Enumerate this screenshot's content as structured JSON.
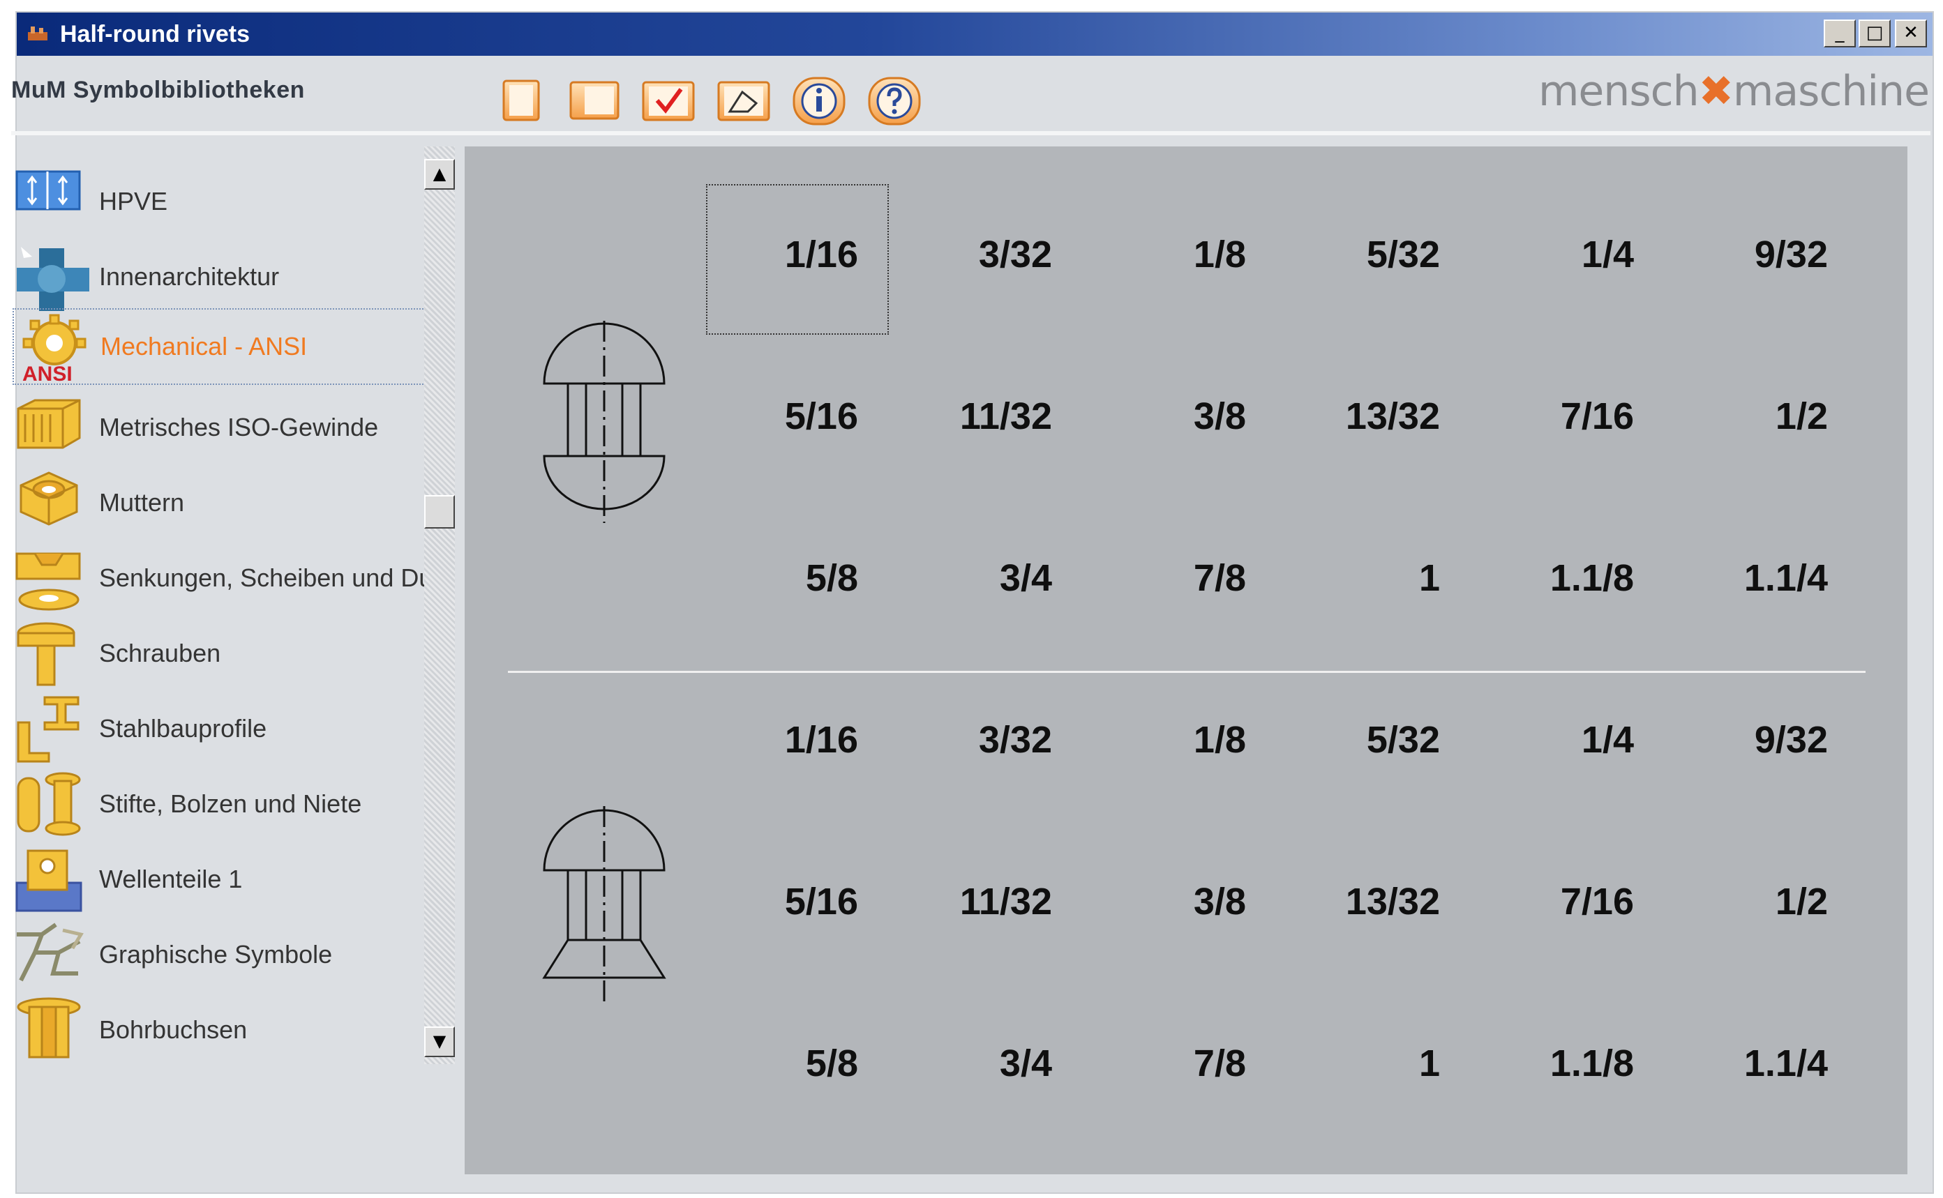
{
  "window": {
    "title": "Half-round rivets",
    "controls": [
      "_",
      "□",
      "✕"
    ]
  },
  "toolbar": {
    "library_title": "MuM Symbolbibliotheken",
    "buttons": [
      "new-doc",
      "open-panel",
      "check",
      "place-symbol",
      "info",
      "help"
    ],
    "brand": {
      "left": "mensch",
      "mark": "✖",
      "right": "maschine"
    }
  },
  "sidebar": {
    "selected_index": 2,
    "items": [
      {
        "label": "HPVE",
        "icon": "hpve-icon"
      },
      {
        "label": "Innenarchitektur",
        "icon": "interior-icon"
      },
      {
        "label": "Mechanical - ANSI",
        "icon": "gear-ansi-icon",
        "badge": "ANSI"
      },
      {
        "label": "Metrisches ISO-Gewinde",
        "icon": "thread-icon"
      },
      {
        "label": "Muttern",
        "icon": "nut-icon"
      },
      {
        "label": "Senkungen, Scheiben und Du",
        "icon": "washer-icon"
      },
      {
        "label": "Schrauben",
        "icon": "screw-icon"
      },
      {
        "label": "Stahlbauprofile",
        "icon": "steel-profile-icon"
      },
      {
        "label": "Stifte, Bolzen und Niete",
        "icon": "pin-icon"
      },
      {
        "label": "Wellenteile 1",
        "icon": "shaft-icon"
      },
      {
        "label": "Graphische Symbole",
        "icon": "graphic-symbol-icon"
      },
      {
        "label": "Bohrbuchsen",
        "icon": "bushing-icon"
      }
    ]
  },
  "groups": [
    {
      "symbol": "half-round-rivet-icon",
      "rows": [
        [
          "1/16",
          "3/32",
          "1/8",
          "5/32",
          "1/4",
          "9/32"
        ],
        [
          "5/16",
          "11/32",
          "3/8",
          "13/32",
          "7/16",
          "1/2"
        ],
        [
          "5/8",
          "3/4",
          "7/8",
          "1",
          "1.1/8",
          "1.1/4"
        ]
      ]
    },
    {
      "symbol": "countersunk-rivet-icon",
      "rows": [
        [
          "1/16",
          "3/32",
          "1/8",
          "5/32",
          "1/4",
          "9/32"
        ],
        [
          "5/16",
          "11/32",
          "3/8",
          "13/32",
          "7/16",
          "1/2"
        ],
        [
          "5/8",
          "3/4",
          "7/8",
          "1",
          "1.1/8",
          "1.1/4"
        ]
      ]
    }
  ],
  "colors": {
    "accent": "#f07a20",
    "title_bar": "#0a2a7a",
    "content_bg": "#b3b6ba"
  }
}
